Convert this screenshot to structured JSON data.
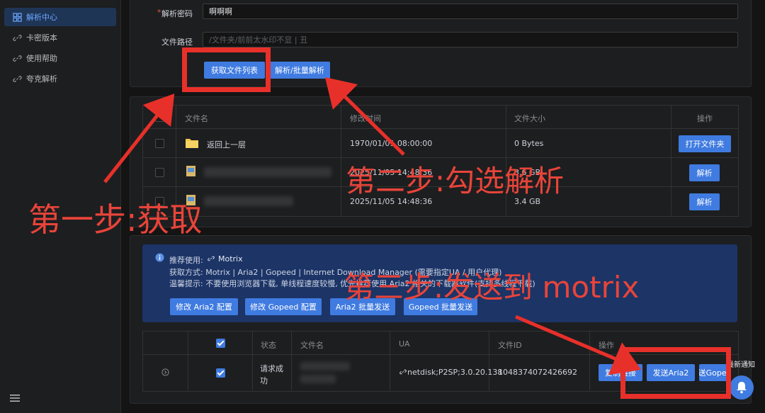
{
  "sidebar": {
    "items": [
      {
        "label": "解析中心",
        "icon": "grid-icon",
        "active": true
      },
      {
        "label": "卡密版本",
        "icon": "link-icon",
        "active": false
      },
      {
        "label": "使用帮助",
        "icon": "link-icon",
        "active": false
      },
      {
        "label": "夸克解析",
        "icon": "link-icon",
        "active": false
      }
    ],
    "collapse_icon": "menu-icon"
  },
  "form": {
    "password_label": "解析密码",
    "password_value": "啊啊啊",
    "path_label": "文件路径",
    "path_placeholder": "/文件夹/前前太水印不显 | 丑",
    "get_list_button": "获取文件列表",
    "batch_button": "解析/批量解析"
  },
  "files_table": {
    "headers": [
      "文件名",
      "修改时间",
      "文件大小",
      "操作"
    ],
    "rows": [
      {
        "name": "返回上一层",
        "time": "1970/01/01 08:00:00",
        "size": "0 Bytes",
        "action": "打开文件夹",
        "icon": "folder-icon"
      },
      {
        "name": "",
        "time": "2025/11/05 14:48:36",
        "size": "3.6 GB",
        "action": "解析",
        "icon": "file-icon"
      },
      {
        "name": "",
        "time": "2025/11/05 14:48:36",
        "size": "3.4 GB",
        "action": "解析",
        "icon": "file-icon"
      }
    ]
  },
  "info": {
    "recommend_label": "推荐使用:",
    "recommend_link": "Motrix",
    "method_text": "获取方式: Motrix | Aria2 | Gopeed | Internet Download Manager (需要指定UA / 用户代理)",
    "tip_text": "温馨提示: 不要使用浏览器下载, 单线程速度较慢, 优先推荐使用 Aria2 相关的下载器软件(支持多线程下载)",
    "buttons": [
      "修改 Aria2 配置",
      "修改 Gopeed 配置",
      "Aria2 批量发送",
      "Gopeed 批量发送"
    ]
  },
  "result_table": {
    "headers": [
      "状态",
      "文件名",
      "UA",
      "文件ID",
      "操作"
    ],
    "row": {
      "status": "请求成功",
      "ua": "netdisk;P2SP;3.0.20.138",
      "file_id": "1048374072426692",
      "actions": [
        "复制链接",
        "发送Aria2",
        "发送Gopeed"
      ]
    }
  },
  "notification": {
    "label": "最新通知",
    "icon": "bell-icon"
  },
  "annotations": {
    "step1": "第一步:获取",
    "step2": "第二步:勾选解析",
    "step3": "第三步:发送到 motrix"
  },
  "colors": {
    "accent": "#3f7be0",
    "annotation": "#e8443a",
    "info_bg": "#1c3466"
  }
}
